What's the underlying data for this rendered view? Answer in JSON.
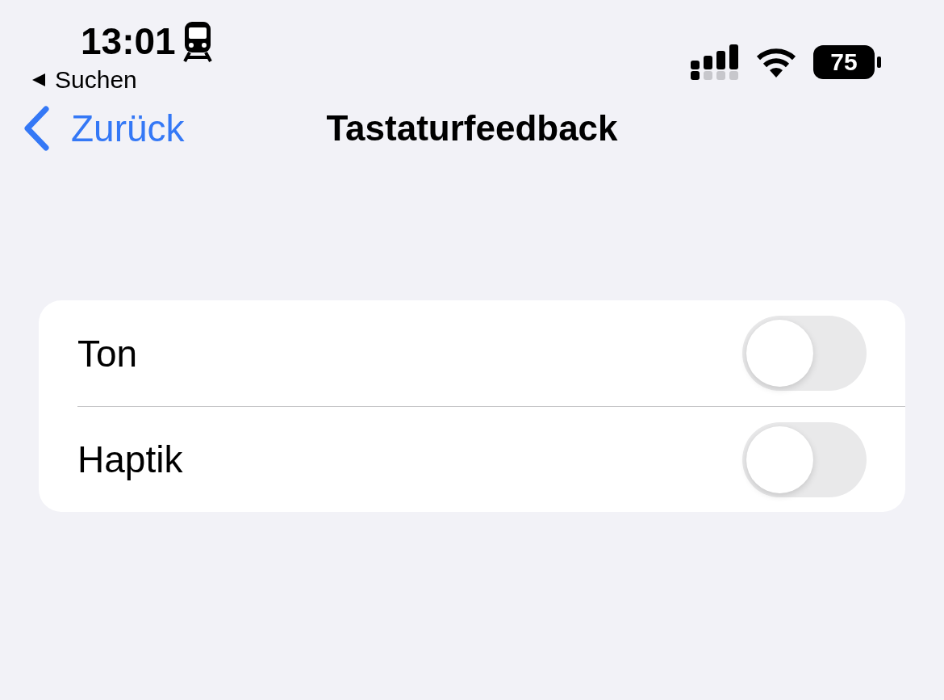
{
  "status_bar": {
    "time": "13:01",
    "back_app": "Suchen",
    "battery": "75"
  },
  "nav": {
    "back": "Zurück",
    "title": "Tastaturfeedback"
  },
  "rows": [
    {
      "label": "Ton",
      "on": false
    },
    {
      "label": "Haptik",
      "on": false
    }
  ]
}
